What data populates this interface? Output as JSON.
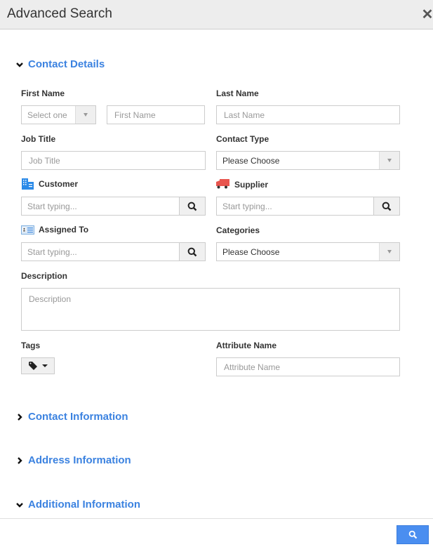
{
  "header": {
    "title": "Advanced Search",
    "close_icon": "close-icon"
  },
  "sections": {
    "contact_details": {
      "label": "Contact Details",
      "expanded": true
    },
    "contact_information": {
      "label": "Contact Information",
      "expanded": false
    },
    "address_information": {
      "label": "Address Information",
      "expanded": false
    },
    "additional_information": {
      "label": "Additional Information",
      "expanded": true
    }
  },
  "form": {
    "first_name": {
      "label": "First Name",
      "salutation_value": "Select one",
      "placeholder": "First Name"
    },
    "last_name": {
      "label": "Last Name",
      "placeholder": "Last Name"
    },
    "job_title": {
      "label": "Job Title",
      "placeholder": "Job Title"
    },
    "contact_type": {
      "label": "Contact Type",
      "value": "Please Choose"
    },
    "customer": {
      "label": "Customer",
      "placeholder": "Start typing...",
      "icon": "building-icon"
    },
    "supplier": {
      "label": "Supplier",
      "placeholder": "Start typing...",
      "icon": "truck-icon"
    },
    "assigned_to": {
      "label": "Assigned To",
      "placeholder": "Start typing...",
      "icon": "id-card-icon"
    },
    "categories": {
      "label": "Categories",
      "value": "Please Choose"
    },
    "description": {
      "label": "Description",
      "placeholder": "Description"
    },
    "tags": {
      "label": "Tags",
      "icon": "tag-icon"
    },
    "attribute_name": {
      "label": "Attribute Name",
      "placeholder": "Attribute Name"
    }
  },
  "colors": {
    "accent": "#3b82e0",
    "button": "#4a8ef0",
    "truck": "#e8554e",
    "building": "#2b8ae8"
  }
}
